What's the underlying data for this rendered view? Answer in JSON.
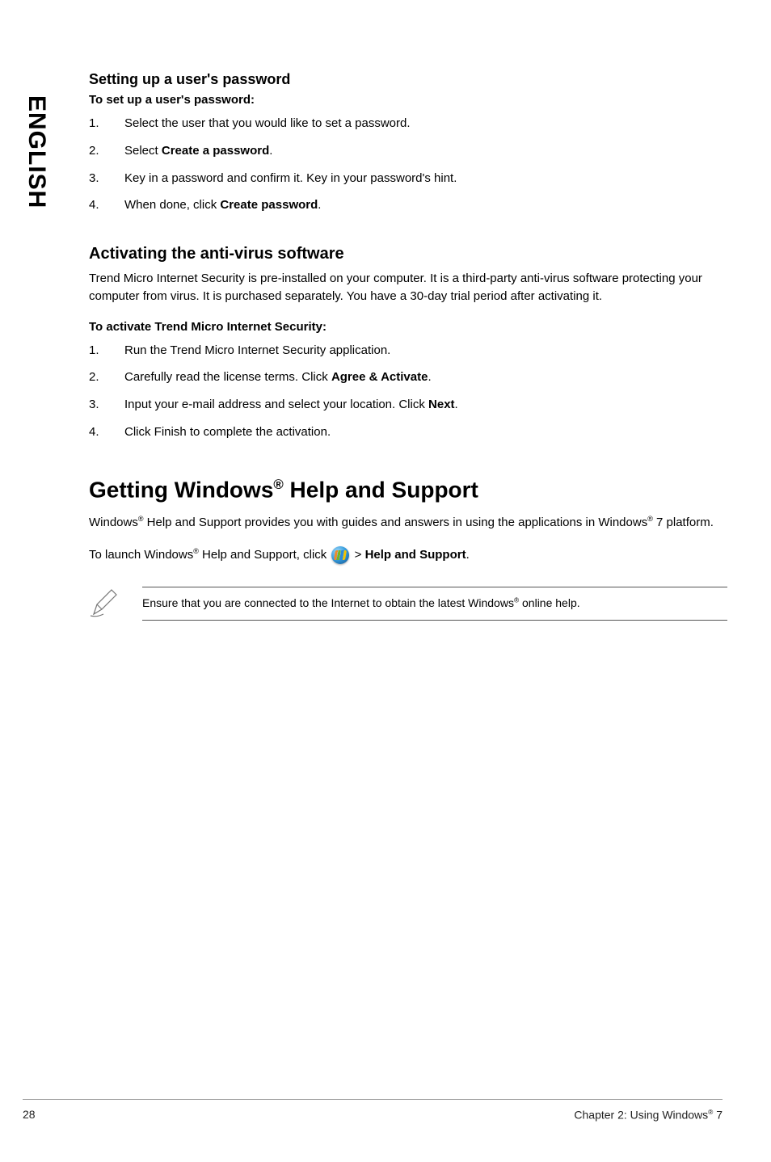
{
  "side_tab": "ENGLISH",
  "sec1": {
    "title": "Setting up a user's password",
    "subtitle": "To set up a user's password:",
    "s1": "Select the user that you would like to set a password.",
    "s2_a": "Select ",
    "s2_b": "Create a password",
    "s2_c": ".",
    "s3": "Key in a password and confirm it. Key in your password's hint.",
    "s4_a": "When done, click ",
    "s4_b": "Create password",
    "s4_c": "."
  },
  "sec2": {
    "title": "Activating the anti-virus software",
    "intro": "Trend Micro Internet Security is pre-installed on your computer. It is a third-party anti-virus software protecting your computer from virus. It is purchased separately. You have a 30-day trial period after activating it.",
    "subtitle": "To activate Trend Micro Internet Security:",
    "s1": "Run the Trend Micro Internet Security application.",
    "s2_a": "Carefully read the license terms. Click ",
    "s2_b": "Agree & Activate",
    "s2_c": ".",
    "s3_a": "Input your e-mail address and select your location. Click ",
    "s3_b": "Next",
    "s3_c": ".",
    "s4": "Click Finish to complete the activation."
  },
  "sec3": {
    "title_a": "Getting Windows",
    "title_sup": "®",
    "title_b": " Help and Support",
    "p_a": "Windows",
    "p_sup": "®",
    "p_b": " Help and Support provides you with guides and answers in using the applications in Windows",
    "p_sup2": "®",
    "p_c": " 7 platform.",
    "launch_a": "To launch Windows",
    "launch_sup": "®",
    "launch_b": " Help and Support, click ",
    "launch_gt": " > ",
    "launch_bold": "Help and Support",
    "launch_c": ".",
    "note_a": "Ensure that you are connected to the Internet to obtain the latest Windows",
    "note_sup": "®",
    "note_b": " online help."
  },
  "footer": {
    "page": "28",
    "chapter_a": "Chapter 2: Using Windows",
    "chapter_sup": "®",
    "chapter_b": " 7"
  }
}
